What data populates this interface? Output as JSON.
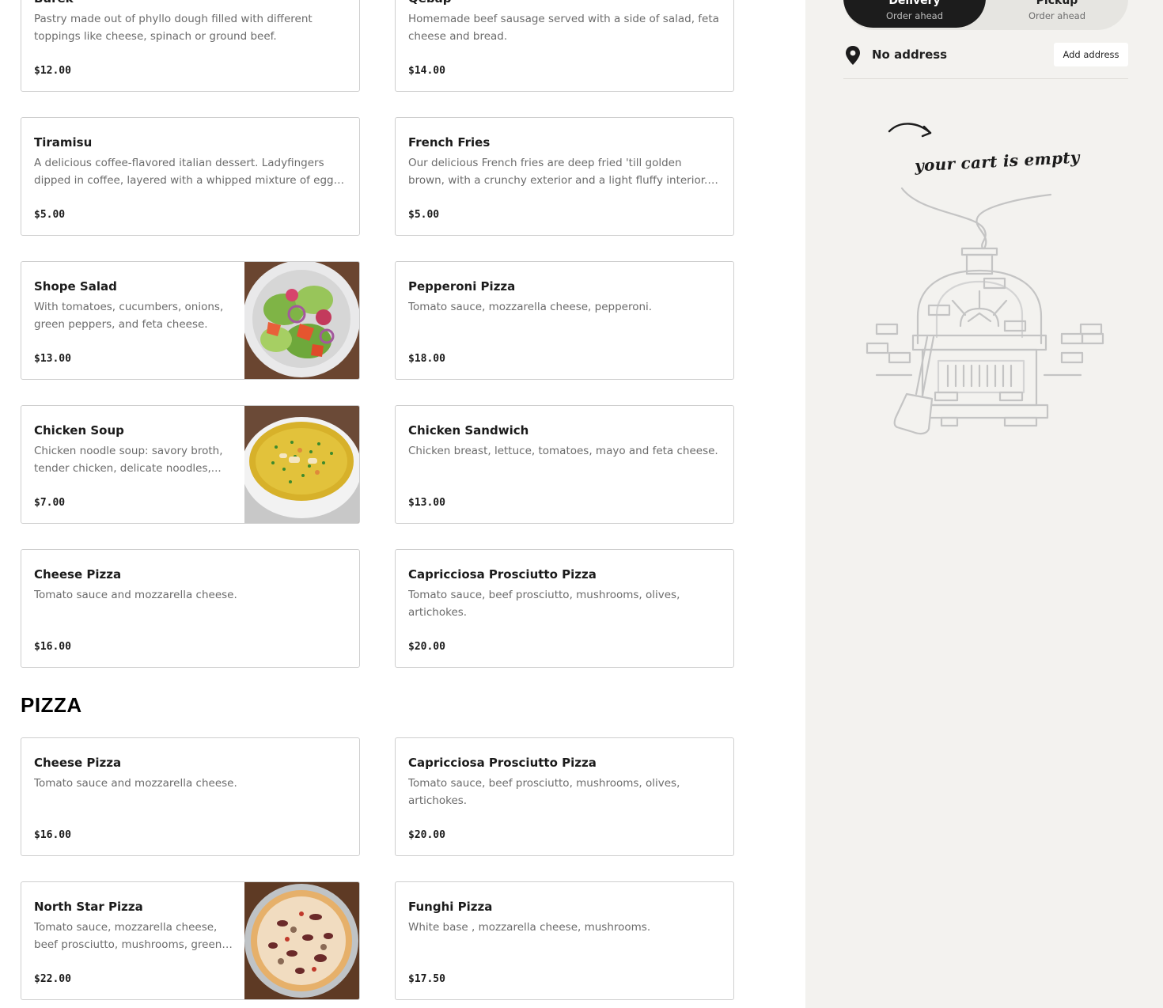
{
  "menu": {
    "items": [
      {
        "title": "Burek",
        "description": "Pastry made out of phyllo dough filled with different toppings like cheese, spinach or ground beef.",
        "price": "$12.00"
      },
      {
        "title": "Qebap",
        "description": "Homemade beef sausage served with a side of salad, feta cheese and bread.",
        "price": "$14.00"
      },
      {
        "title": "Tiramisu",
        "description": "A delicious coffee-flavored italian dessert. Ladyfingers dipped in coffee, layered with a whipped mixture of eggs, sugar &...",
        "price": "$5.00"
      },
      {
        "title": "French Fries",
        "description": "Our delicious French fries are deep fried 'till golden brown, with a crunchy exterior and a light fluffy interior. Seasoned t...",
        "price": "$5.00"
      },
      {
        "title": "Shope Salad",
        "description": "With tomatoes, cucumbers, onions, green peppers, and feta cheese.",
        "price": "$13.00",
        "image": "salad-photo"
      },
      {
        "title": "Pepperoni Pizza",
        "description": "Tomato sauce, mozzarella cheese, pepperoni.",
        "price": "$18.00"
      },
      {
        "title": "Chicken Soup",
        "description": "Chicken noodle soup: savory broth, tender chicken, delicate noodles,...",
        "price": "$7.00",
        "image": "soup-photo"
      },
      {
        "title": "Chicken Sandwich",
        "description": "Chicken breast, lettuce, tomatoes, mayo and feta cheese.",
        "price": "$13.00"
      },
      {
        "title": "Cheese Pizza",
        "description": "Tomato sauce and mozzarella cheese.",
        "price": "$16.00"
      },
      {
        "title": "Capricciosa Prosciutto Pizza",
        "description": "Tomato sauce, beef prosciutto, mushrooms, olives, artichokes.",
        "price": "$20.00"
      }
    ]
  },
  "pizza_section": {
    "title": "PIZZA",
    "items": [
      {
        "title": "Cheese Pizza",
        "description": "Tomato sauce and mozzarella cheese.",
        "price": "$16.00"
      },
      {
        "title": "Capricciosa Prosciutto Pizza",
        "description": "Tomato sauce, beef prosciutto, mushrooms, olives, artichokes.",
        "price": "$20.00"
      },
      {
        "title": "North Star Pizza",
        "description": "Tomato sauce, mozzarella cheese, beef prosciutto, mushrooms, green and re...",
        "price": "$22.00",
        "image": "pizza-photo"
      },
      {
        "title": "Funghi Pizza",
        "description": "White base , mozzarella cheese, mushrooms.",
        "price": "$17.50"
      }
    ]
  },
  "sidebar": {
    "modes": [
      {
        "title": "Delivery",
        "subtitle": "Order ahead",
        "selected": true
      },
      {
        "title": "Pickup",
        "subtitle": "Order ahead",
        "selected": false
      }
    ],
    "address": {
      "text": "No address",
      "button": "Add address",
      "icon": "location-pin-icon"
    },
    "cart": {
      "empty_text": "your cart is empty",
      "illustration": "pizza-oven-illustration"
    }
  },
  "colors": {
    "sidebar_bg": "#f3f2ef",
    "toggle_selected": "#1c1c1c",
    "card_border": "#cfcfcf",
    "text_muted": "#6b6b6b"
  }
}
